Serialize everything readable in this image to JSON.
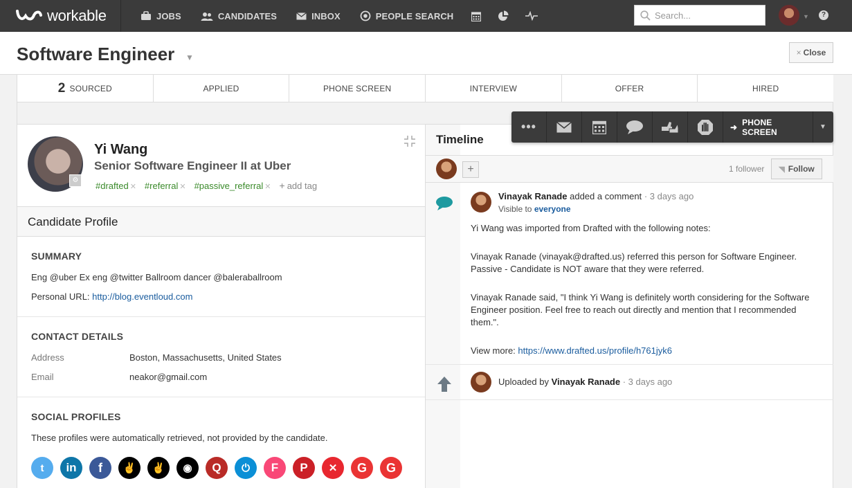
{
  "brand": {
    "name": "workable"
  },
  "nav": {
    "items": [
      {
        "label": "JOBS",
        "icon": "briefcase-icon"
      },
      {
        "label": "CANDIDATES",
        "icon": "people-icon"
      },
      {
        "label": "INBOX",
        "icon": "envelope-icon"
      },
      {
        "label": "PEOPLE SEARCH",
        "icon": "target-icon"
      }
    ],
    "extra_icons": [
      "calendar-icon",
      "pie-chart-icon",
      "activity-icon"
    ],
    "search_placeholder": "Search...",
    "help": "?"
  },
  "job": {
    "title": "Software Engineer",
    "close_label": "Close"
  },
  "stages": [
    {
      "count": "2",
      "label": "SOURCED",
      "active": true
    },
    {
      "count": "",
      "label": "APPLIED"
    },
    {
      "count": "",
      "label": "PHONE SCREEN"
    },
    {
      "count": "",
      "label": "INTERVIEW"
    },
    {
      "count": "",
      "label": "OFFER"
    },
    {
      "count": "",
      "label": "HIRED"
    }
  ],
  "toolbar": {
    "more": "•••",
    "icons": [
      "envelope-icon",
      "calendar-icon",
      "comment-icon",
      "thumbs-icon",
      "disqualify-hand-icon"
    ],
    "move_label": "PHONE SCREEN"
  },
  "candidate": {
    "name": "Yi Wang",
    "headline": "Senior Software Engineer II at Uber",
    "tags": [
      "#drafted",
      "#referral",
      "#passive_referral"
    ],
    "add_tag": "add tag"
  },
  "profile": {
    "title": "Candidate Profile",
    "summary": {
      "title": "SUMMARY",
      "text": "Eng @uber Ex eng @twitter Ballroom dancer @baleraballroom",
      "url_label": "Personal URL:",
      "url": "http://blog.eventloud.com"
    },
    "contact": {
      "title": "CONTACT DETAILS",
      "address_label": "Address",
      "address": "Boston, Massachusetts, United States",
      "email_label": "Email",
      "email": "neakor@gmail.com"
    },
    "social": {
      "title": "SOCIAL PROFILES",
      "note": "These profiles were automatically retrieved, not provided by the candidate.",
      "profiles": [
        {
          "name": "twitter-icon",
          "color": "#55acee",
          "glyph": "t"
        },
        {
          "name": "linkedin-icon",
          "color": "#0e76a8",
          "glyph": "in"
        },
        {
          "name": "facebook-icon",
          "color": "#3b5998",
          "glyph": "f"
        },
        {
          "name": "angellist-icon",
          "color": "#000000",
          "glyph": "✌"
        },
        {
          "name": "angellist-icon",
          "color": "#000000",
          "glyph": "✌"
        },
        {
          "name": "github-icon",
          "color": "#000000",
          "glyph": "◉"
        },
        {
          "name": "quora-icon",
          "color": "#b92b27",
          "glyph": "Q"
        },
        {
          "name": "power-icon",
          "color": "#0b8fd6",
          "glyph": "⏻"
        },
        {
          "name": "foursquare-icon",
          "color": "#f94877",
          "glyph": "F"
        },
        {
          "name": "pinterest-icon",
          "color": "#cb2027",
          "glyph": "P"
        },
        {
          "name": "xing-icon",
          "color": "#e8272f",
          "glyph": "✕"
        },
        {
          "name": "google-icon",
          "color": "#ea3434",
          "glyph": "G"
        },
        {
          "name": "google-icon",
          "color": "#ea3434",
          "glyph": "G"
        }
      ]
    }
  },
  "timeline": {
    "title": "Timeline",
    "followers": "1 follower",
    "follow_label": "Follow",
    "comment": {
      "author": "Vinayak Ranade",
      "action": "added a comment",
      "time": "· 3 days ago",
      "visibility_prefix": "Visible to",
      "visibility": "everyone",
      "p1": "Yi Wang was imported from Drafted with the following notes:",
      "p2": "Vinayak Ranade (vinayak@drafted.us) referred this person for Software Engineer. Passive - Candidate is NOT aware that they were referred.",
      "p3": "Vinayak Ranade said, \"I think Yi Wang is definitely worth considering for the Software Engineer position. Feel free to reach out directly and mention that I recommended them.\".",
      "view_more_label": "View more:",
      "view_more_url": "https://www.drafted.us/profile/h761jyk6"
    },
    "upload": {
      "prefix": "Uploaded by",
      "author": "Vinayak Ranade",
      "time": "· 3 days ago"
    }
  }
}
